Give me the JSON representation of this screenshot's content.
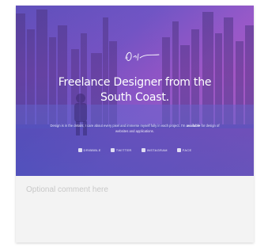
{
  "hero": {
    "signature_icon": "signature-logo",
    "headline_line1": "Freelance Designer from the",
    "headline_line2": "South Coast.",
    "intro_text": "Design is in the details; I care about every pixel and immerse myself fully in each project. I'm",
    "intro_bold": "available",
    "intro_rest": "for design of websites and applications.",
    "social": [
      {
        "label": "DRIBBBLE",
        "icon": "dribbble-icon"
      },
      {
        "label": "TWITTER",
        "icon": "twitter-icon"
      },
      {
        "label": "INSTAGRAM",
        "icon": "instagram-icon"
      },
      {
        "label": "FACE",
        "icon": "facebook-icon"
      }
    ]
  },
  "comment": {
    "placeholder": "Optional comment here",
    "value": ""
  },
  "colors": {
    "gradient_start": "#5b4fb8",
    "gradient_end": "#c35dbf",
    "comment_bg": "#f3f3f3"
  }
}
